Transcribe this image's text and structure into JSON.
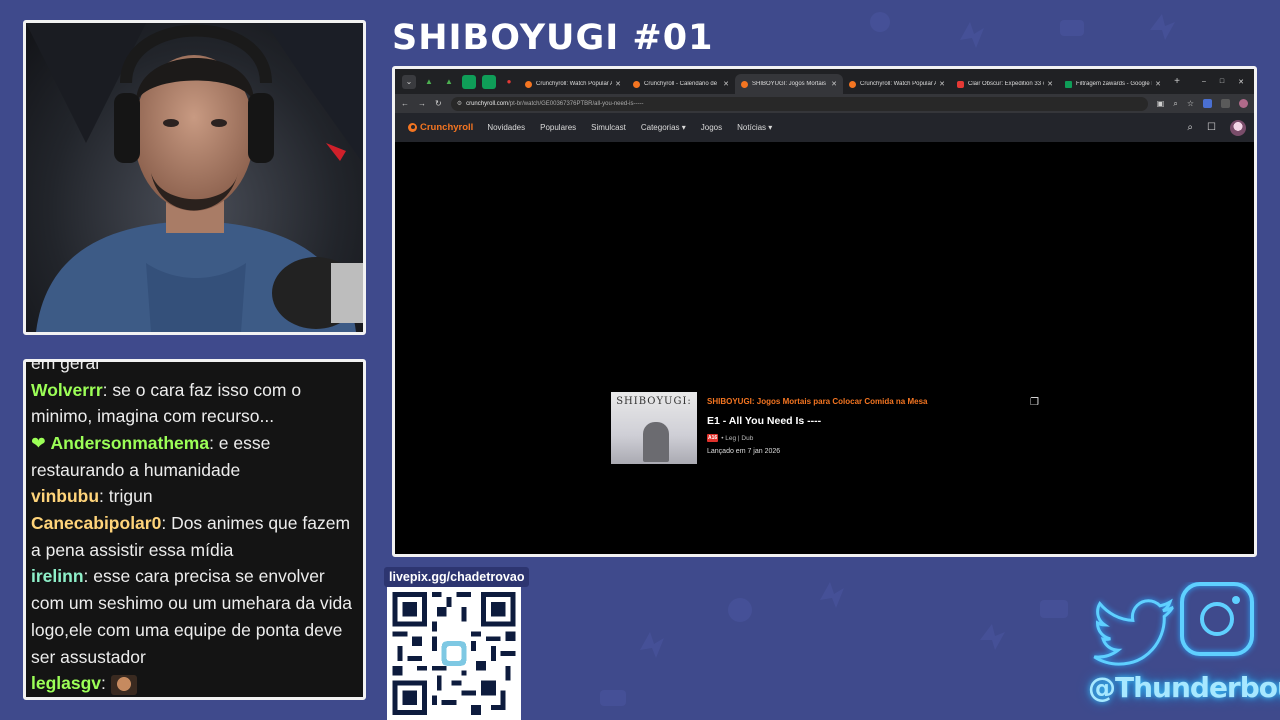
{
  "stream": {
    "title": "SHIBOYUGI #01",
    "pix_url": "livepix.gg/chadetrovao",
    "social_handle": "@Thunderbout"
  },
  "chat": {
    "messages": [
      {
        "user": "",
        "user_color": "#ededed",
        "text": "em geral"
      },
      {
        "user": "Wolverrr",
        "user_color": "#9cff57",
        "text": "se o cara faz isso com o minimo, imagina com recurso..."
      },
      {
        "user": "Andersonmathema",
        "user_color": "#9cff57",
        "badge": "heart",
        "text": "e esse restaurando a humanidade"
      },
      {
        "user": "vinbubu",
        "user_color": "#ffd47a",
        "text": "trigun"
      },
      {
        "user": "Canecabipolar0",
        "user_color": "#ffd47a",
        "text": "Dos animes que fazem a pena assistir essa mídia"
      },
      {
        "user": "irelinn",
        "user_color": "#8ef0c9",
        "text": "esse cara precisa se envolver com um seshimo ou um umehara da vida logo,ele com uma equipe de ponta deve ser assustador"
      },
      {
        "user": "leglasgv",
        "user_color": "#9cff57",
        "text": "",
        "emote": true
      }
    ]
  },
  "browser": {
    "tabs": [
      {
        "label": "Crunchyroll: Watch Popular Ani",
        "color": "#f47521"
      },
      {
        "label": "Crunchyroll - Calendário de Tra",
        "color": "#f47521"
      },
      {
        "label": "SHIBOYUGI: Jogos Mortais para",
        "color": "#f47521",
        "active": true
      },
      {
        "label": "Crunchyroll: Watch Popular Ani",
        "color": "#f47521"
      },
      {
        "label": "Clair Obscur: Expedition 33 #17",
        "color": "#e53935"
      },
      {
        "label": "Filtragem zawards - Google Pl",
        "color": "#0f9d58"
      }
    ],
    "url_domain": "crunchyroll.com",
    "url_path": "/pt-br/watch/GE00367376PTBR/all-you-need-is-----"
  },
  "crunchyroll": {
    "logo": "Crunchyroll",
    "nav": [
      "Novidades",
      "Populares",
      "Simulcast",
      "Categorias",
      "Jogos",
      "Notícias"
    ],
    "episode": {
      "series": "SHIBOYUGI: Jogos Mortais para Colocar Comida na Mesa",
      "title": "E1 - All You Need Is ----",
      "rating": "A16",
      "meta": "• Leg | Dub",
      "release": "Lançado em 7 jan 2026",
      "thumb_text": "SHIBOYUGI:"
    }
  }
}
